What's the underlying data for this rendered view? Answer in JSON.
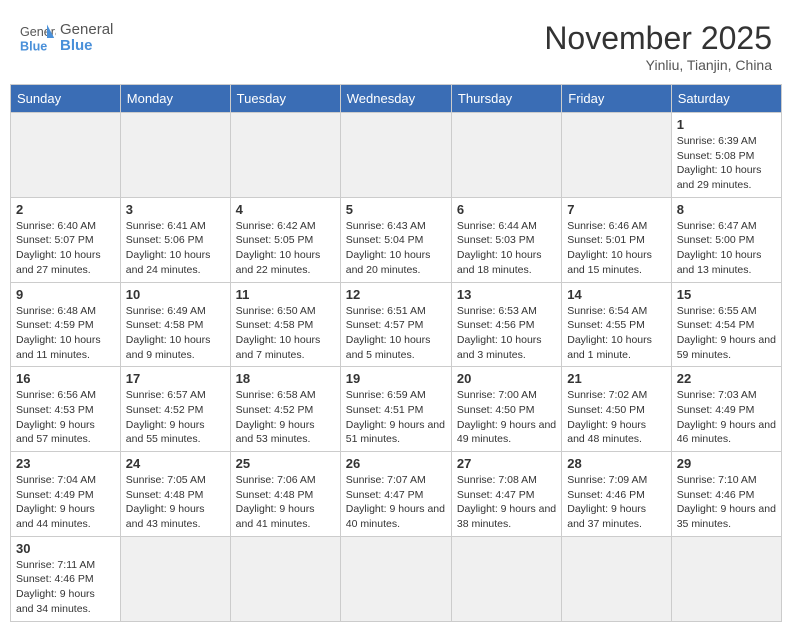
{
  "header": {
    "logo_general": "General",
    "logo_blue": "Blue",
    "month_title": "November 2025",
    "location": "Yinliu, Tianjin, China"
  },
  "weekdays": [
    "Sunday",
    "Monday",
    "Tuesday",
    "Wednesday",
    "Thursday",
    "Friday",
    "Saturday"
  ],
  "weeks": [
    [
      {
        "day": "",
        "info": ""
      },
      {
        "day": "",
        "info": ""
      },
      {
        "day": "",
        "info": ""
      },
      {
        "day": "",
        "info": ""
      },
      {
        "day": "",
        "info": ""
      },
      {
        "day": "",
        "info": ""
      },
      {
        "day": "1",
        "info": "Sunrise: 6:39 AM\nSunset: 5:08 PM\nDaylight: 10 hours and 29 minutes."
      }
    ],
    [
      {
        "day": "2",
        "info": "Sunrise: 6:40 AM\nSunset: 5:07 PM\nDaylight: 10 hours and 27 minutes."
      },
      {
        "day": "3",
        "info": "Sunrise: 6:41 AM\nSunset: 5:06 PM\nDaylight: 10 hours and 24 minutes."
      },
      {
        "day": "4",
        "info": "Sunrise: 6:42 AM\nSunset: 5:05 PM\nDaylight: 10 hours and 22 minutes."
      },
      {
        "day": "5",
        "info": "Sunrise: 6:43 AM\nSunset: 5:04 PM\nDaylight: 10 hours and 20 minutes."
      },
      {
        "day": "6",
        "info": "Sunrise: 6:44 AM\nSunset: 5:03 PM\nDaylight: 10 hours and 18 minutes."
      },
      {
        "day": "7",
        "info": "Sunrise: 6:46 AM\nSunset: 5:01 PM\nDaylight: 10 hours and 15 minutes."
      },
      {
        "day": "8",
        "info": "Sunrise: 6:47 AM\nSunset: 5:00 PM\nDaylight: 10 hours and 13 minutes."
      }
    ],
    [
      {
        "day": "9",
        "info": "Sunrise: 6:48 AM\nSunset: 4:59 PM\nDaylight: 10 hours and 11 minutes."
      },
      {
        "day": "10",
        "info": "Sunrise: 6:49 AM\nSunset: 4:58 PM\nDaylight: 10 hours and 9 minutes."
      },
      {
        "day": "11",
        "info": "Sunrise: 6:50 AM\nSunset: 4:58 PM\nDaylight: 10 hours and 7 minutes."
      },
      {
        "day": "12",
        "info": "Sunrise: 6:51 AM\nSunset: 4:57 PM\nDaylight: 10 hours and 5 minutes."
      },
      {
        "day": "13",
        "info": "Sunrise: 6:53 AM\nSunset: 4:56 PM\nDaylight: 10 hours and 3 minutes."
      },
      {
        "day": "14",
        "info": "Sunrise: 6:54 AM\nSunset: 4:55 PM\nDaylight: 10 hours and 1 minute."
      },
      {
        "day": "15",
        "info": "Sunrise: 6:55 AM\nSunset: 4:54 PM\nDaylight: 9 hours and 59 minutes."
      }
    ],
    [
      {
        "day": "16",
        "info": "Sunrise: 6:56 AM\nSunset: 4:53 PM\nDaylight: 9 hours and 57 minutes."
      },
      {
        "day": "17",
        "info": "Sunrise: 6:57 AM\nSunset: 4:52 PM\nDaylight: 9 hours and 55 minutes."
      },
      {
        "day": "18",
        "info": "Sunrise: 6:58 AM\nSunset: 4:52 PM\nDaylight: 9 hours and 53 minutes."
      },
      {
        "day": "19",
        "info": "Sunrise: 6:59 AM\nSunset: 4:51 PM\nDaylight: 9 hours and 51 minutes."
      },
      {
        "day": "20",
        "info": "Sunrise: 7:00 AM\nSunset: 4:50 PM\nDaylight: 9 hours and 49 minutes."
      },
      {
        "day": "21",
        "info": "Sunrise: 7:02 AM\nSunset: 4:50 PM\nDaylight: 9 hours and 48 minutes."
      },
      {
        "day": "22",
        "info": "Sunrise: 7:03 AM\nSunset: 4:49 PM\nDaylight: 9 hours and 46 minutes."
      }
    ],
    [
      {
        "day": "23",
        "info": "Sunrise: 7:04 AM\nSunset: 4:49 PM\nDaylight: 9 hours and 44 minutes."
      },
      {
        "day": "24",
        "info": "Sunrise: 7:05 AM\nSunset: 4:48 PM\nDaylight: 9 hours and 43 minutes."
      },
      {
        "day": "25",
        "info": "Sunrise: 7:06 AM\nSunset: 4:48 PM\nDaylight: 9 hours and 41 minutes."
      },
      {
        "day": "26",
        "info": "Sunrise: 7:07 AM\nSunset: 4:47 PM\nDaylight: 9 hours and 40 minutes."
      },
      {
        "day": "27",
        "info": "Sunrise: 7:08 AM\nSunset: 4:47 PM\nDaylight: 9 hours and 38 minutes."
      },
      {
        "day": "28",
        "info": "Sunrise: 7:09 AM\nSunset: 4:46 PM\nDaylight: 9 hours and 37 minutes."
      },
      {
        "day": "29",
        "info": "Sunrise: 7:10 AM\nSunset: 4:46 PM\nDaylight: 9 hours and 35 minutes."
      }
    ],
    [
      {
        "day": "30",
        "info": "Sunrise: 7:11 AM\nSunset: 4:46 PM\nDaylight: 9 hours and 34 minutes."
      },
      {
        "day": "",
        "info": ""
      },
      {
        "day": "",
        "info": ""
      },
      {
        "day": "",
        "info": ""
      },
      {
        "day": "",
        "info": ""
      },
      {
        "day": "",
        "info": ""
      },
      {
        "day": "",
        "info": ""
      }
    ]
  ]
}
